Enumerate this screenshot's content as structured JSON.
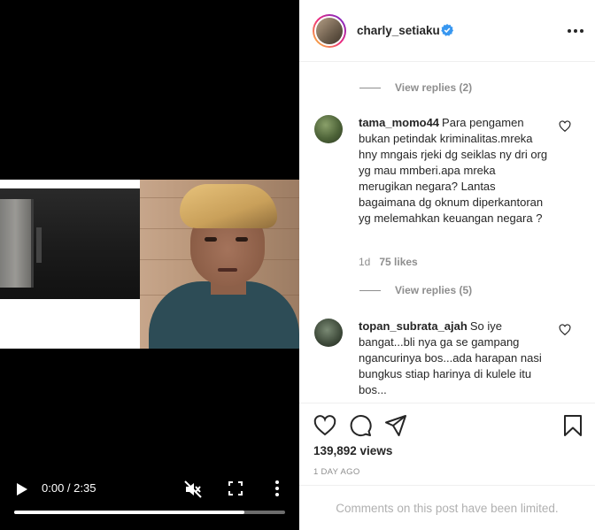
{
  "video": {
    "time": "0:00 / 2:35",
    "progress": 0.85,
    "icons": {
      "play": "play-icon",
      "mute": "muted-speaker-icon",
      "fullscreen": "fullscreen-icon",
      "more": "vertical-ellipsis-icon"
    }
  },
  "post": {
    "username": "charly_setiaku",
    "verified": true,
    "accent": "#0095f6"
  },
  "comments": [
    {
      "type": "view_replies",
      "label": "View replies (2)"
    },
    {
      "type": "comment",
      "username": "tama_momo44",
      "text": "Para pengamen bukan petindak kriminalitas.mreka hny mngais rjeki dg seiklas ny dri org yg mau mmberi.apa mreka merugikan negara? Lantas bagaimana dg oknum diperkantoran yg melemahkan keuangan negara ?",
      "age": "1d",
      "likes": "75 likes"
    },
    {
      "type": "view_replies",
      "label": "View replies (5)"
    },
    {
      "type": "comment",
      "username": "topan_subrata_ajah",
      "text": "So iye bangat...bli nya ga se gampang ngancurinya bos...ada harapan nasi bungkus stiap harinya di kulele itu bos..."
    }
  ],
  "actions": {
    "views": "139,892 views",
    "posted": "1 DAY AGO",
    "icons": [
      "heart-icon",
      "comment-icon",
      "share-icon",
      "bookmark-icon"
    ]
  },
  "footer": {
    "limited_text": "Comments on this post have been limited."
  }
}
